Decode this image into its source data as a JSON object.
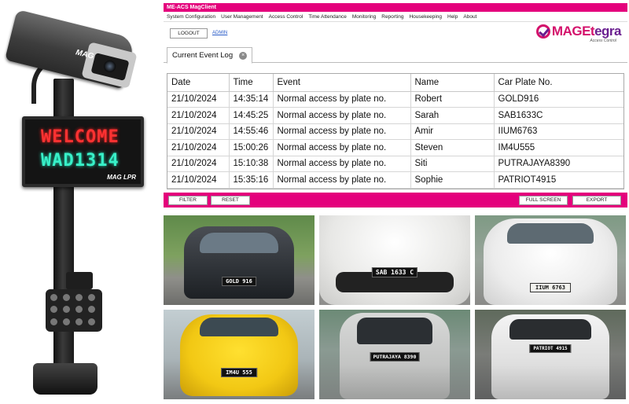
{
  "hardware": {
    "camera_logo": "MAG",
    "led_line1": "WELCOME",
    "led_line2": "WAD1314",
    "led_brand": "MAG LPR"
  },
  "app": {
    "title": "ME-ACS MagClient",
    "menu": [
      "System Configuration",
      "User Management",
      "Access Control",
      "Time Attendance",
      "Monitoring",
      "Reporting",
      "Housekeeping",
      "Help",
      "About"
    ],
    "logout_label": "LOGOUT",
    "admin_label": "ADMIN",
    "logo": {
      "text_main": "MAGEt",
      "text_tail": "egra",
      "subtitle": "Access Control"
    },
    "tab": {
      "label": "Current Event Log",
      "close_glyph": "×"
    },
    "table": {
      "columns": [
        "Date",
        "Time",
        "Event",
        "Name",
        "Car Plate No."
      ],
      "rows": [
        [
          "21/10/2024",
          "14:35:14",
          "Normal access by plate no.",
          "Robert",
          "GOLD916"
        ],
        [
          "21/10/2024",
          "14:45:25",
          "Normal access by plate no.",
          "Sarah",
          "SAB1633C"
        ],
        [
          "21/10/2024",
          "14:55:46",
          "Normal access by plate no.",
          "Amir",
          "IIUM6763"
        ],
        [
          "21/10/2024",
          "15:00:26",
          "Normal access by plate no.",
          "Steven",
          "IM4U555"
        ],
        [
          "21/10/2024",
          "15:10:38",
          "Normal access by plate no.",
          "Siti",
          "PUTRAJAYA8390"
        ],
        [
          "21/10/2024",
          "15:35:16",
          "Normal access by plate no.",
          "Sophie",
          "PATRIOT4915"
        ]
      ]
    },
    "actions": {
      "filter": "FILTER",
      "reset": "RESET",
      "full_screen": "FULL SCREEN",
      "export": "EXPORT"
    }
  },
  "photos": [
    {
      "plate": "GOLD 916",
      "car_color": "#3b3f45",
      "bg": "#6f8f5a"
    },
    {
      "plate": "SAB 1633 C",
      "car_color": "#f3f3f3",
      "bg": "#9a9a98"
    },
    {
      "plate": "IIUM 6763",
      "car_color": "#f5f5f5",
      "bg": "#8a9a8c"
    },
    {
      "plate": "IM4U 555",
      "car_color": "#f3d21a",
      "bg": "#b9c4c8"
    },
    {
      "plate": "PUTRAJAYA 8390",
      "car_color": "#cfd0cf",
      "bg": "#7d8a86"
    },
    {
      "plate": "PATRIOT 4915",
      "car_color": "#ececec",
      "bg": "#6d7070"
    }
  ],
  "colors": {
    "accent": "#e4007c",
    "logo_purple": "#6a1f8f",
    "led_red": "#ff3232",
    "led_green": "#38f0c8"
  }
}
